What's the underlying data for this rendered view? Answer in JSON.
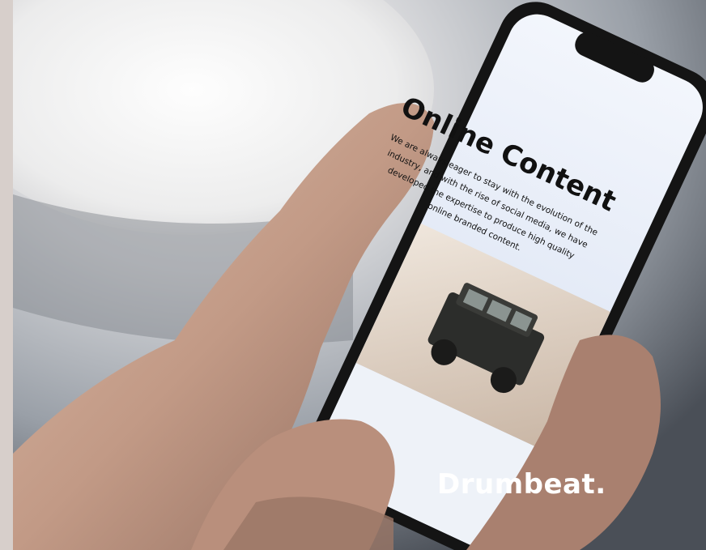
{
  "screen": {
    "heading": "Online Content",
    "body": "We are always eager to stay with the evolution of the industry, and with the rise of social media, we have developed the expertise to produce high quality online branded content."
  },
  "brand": {
    "name": "Drumbeat."
  },
  "colors": {
    "screen_background": "#e8eef9",
    "phone_frame": "#141414",
    "brand_text": "#ffffff"
  }
}
